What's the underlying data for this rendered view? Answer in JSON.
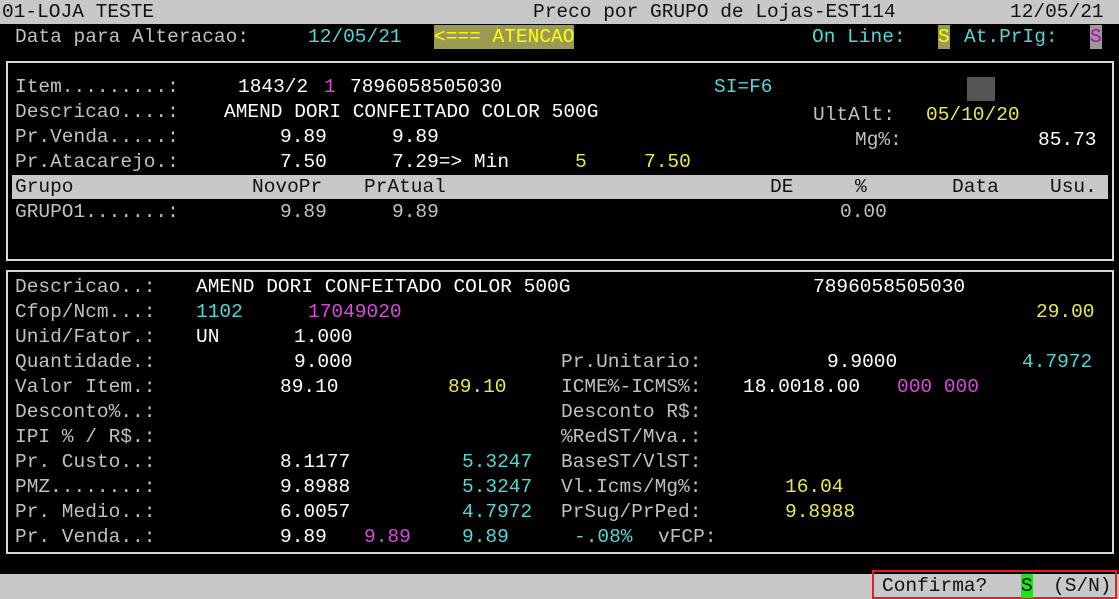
{
  "title_bar": {
    "store": "01-LOJA TESTE",
    "title": "Preco por GRUPO de Lojas-EST114",
    "date": "12/05/21"
  },
  "alteracao": {
    "label": "Data para Alteracao:",
    "date": "12/05/21",
    "warning": "<=== ATENCAO",
    "online_label": "On Line:",
    "online_value": "S",
    "atprig_label": "At.PrIg:",
    "atprig_value": "S"
  },
  "item": {
    "label": "Item.........:",
    "code": "1843/2",
    "code_suffix": "1",
    "ean": "7896058505030",
    "si": "SI=F6",
    "desc_label": "Descricao....:",
    "desc": "AMEND DORI CONFEITADO COLOR 500G",
    "ultalt_label": "UltAlt:",
    "ultalt": "05/10/20",
    "prvenda_label": "Pr.Venda.....:",
    "prvenda_1": "9.89",
    "prvenda_2": "9.89",
    "mg_label": "Mg%:",
    "mg": "85.73",
    "atac_label": "Pr.Atacarejo.:",
    "atac_1": "7.50",
    "atac_2": "7.29=> Min",
    "atac_min": "5",
    "atac_min_val": "7.50"
  },
  "grid": {
    "headers": {
      "grupo": "Grupo",
      "novopr": "NovoPr",
      "pratual": "PrAtual",
      "de": "DE",
      "pct": "%",
      "data": "Data",
      "usu": "Usu."
    },
    "rows": [
      {
        "grupo": "GRUPO1.......:",
        "novopr": "9.89",
        "pratual": "9.89",
        "pct": "0.00"
      }
    ]
  },
  "detail": {
    "desc_label": "Descricao..:",
    "desc": "AMEND DORI CONFEITADO COLOR 500G",
    "ean": "7896058505030",
    "cfop_label": "Cfop/Ncm...:",
    "cfop": "1102",
    "ncm": "17049020",
    "cfop_right": "29.00",
    "unid_label": "Unid/Fator.:",
    "unid": "UN",
    "fator": "1.000",
    "qtd_label": "Quantidade.:",
    "qtd": "9.000",
    "prunit_label": "Pr.Unitario:",
    "prunit": "9.9000",
    "prunit_2": "4.7972",
    "valor_label": "Valor Item.:",
    "valor_1": "89.10",
    "valor_2": "89.10",
    "icms_label": "ICME%-ICMS%:",
    "icms": "18.0018.00",
    "icms_2": "000 000",
    "desc_pct_label": "Desconto%..:",
    "desc_rs_label": "Desconto R$:",
    "ipi_label": "IPI % / R$.:",
    "redst_label": "%RedST/Mva.:",
    "custo_label": "Pr. Custo..:",
    "custo_1": "8.1177",
    "custo_2": "5.3247",
    "basest_label": "BaseST/VlST:",
    "pmz_label": "PMZ........:",
    "pmz_1": "9.8988",
    "pmz_2": "5.3247",
    "vlicms_label": "Vl.Icms/Mg%:",
    "vlicms": "16.04",
    "medio_label": "Pr. Medio..:",
    "medio_1": "6.0057",
    "medio_2": "4.7972",
    "prsug_label": "PrSug/PrPed:",
    "prsug": "9.8988",
    "venda_label": "Pr. Venda..:",
    "venda_1": "9.89",
    "venda_2": "9.89",
    "venda_3": "9.89",
    "venda_pct": "-.08%",
    "vfcp_label": "vFCP:"
  },
  "confirm": {
    "label": "Confirma?",
    "value": "S",
    "options": "(S/N)"
  }
}
